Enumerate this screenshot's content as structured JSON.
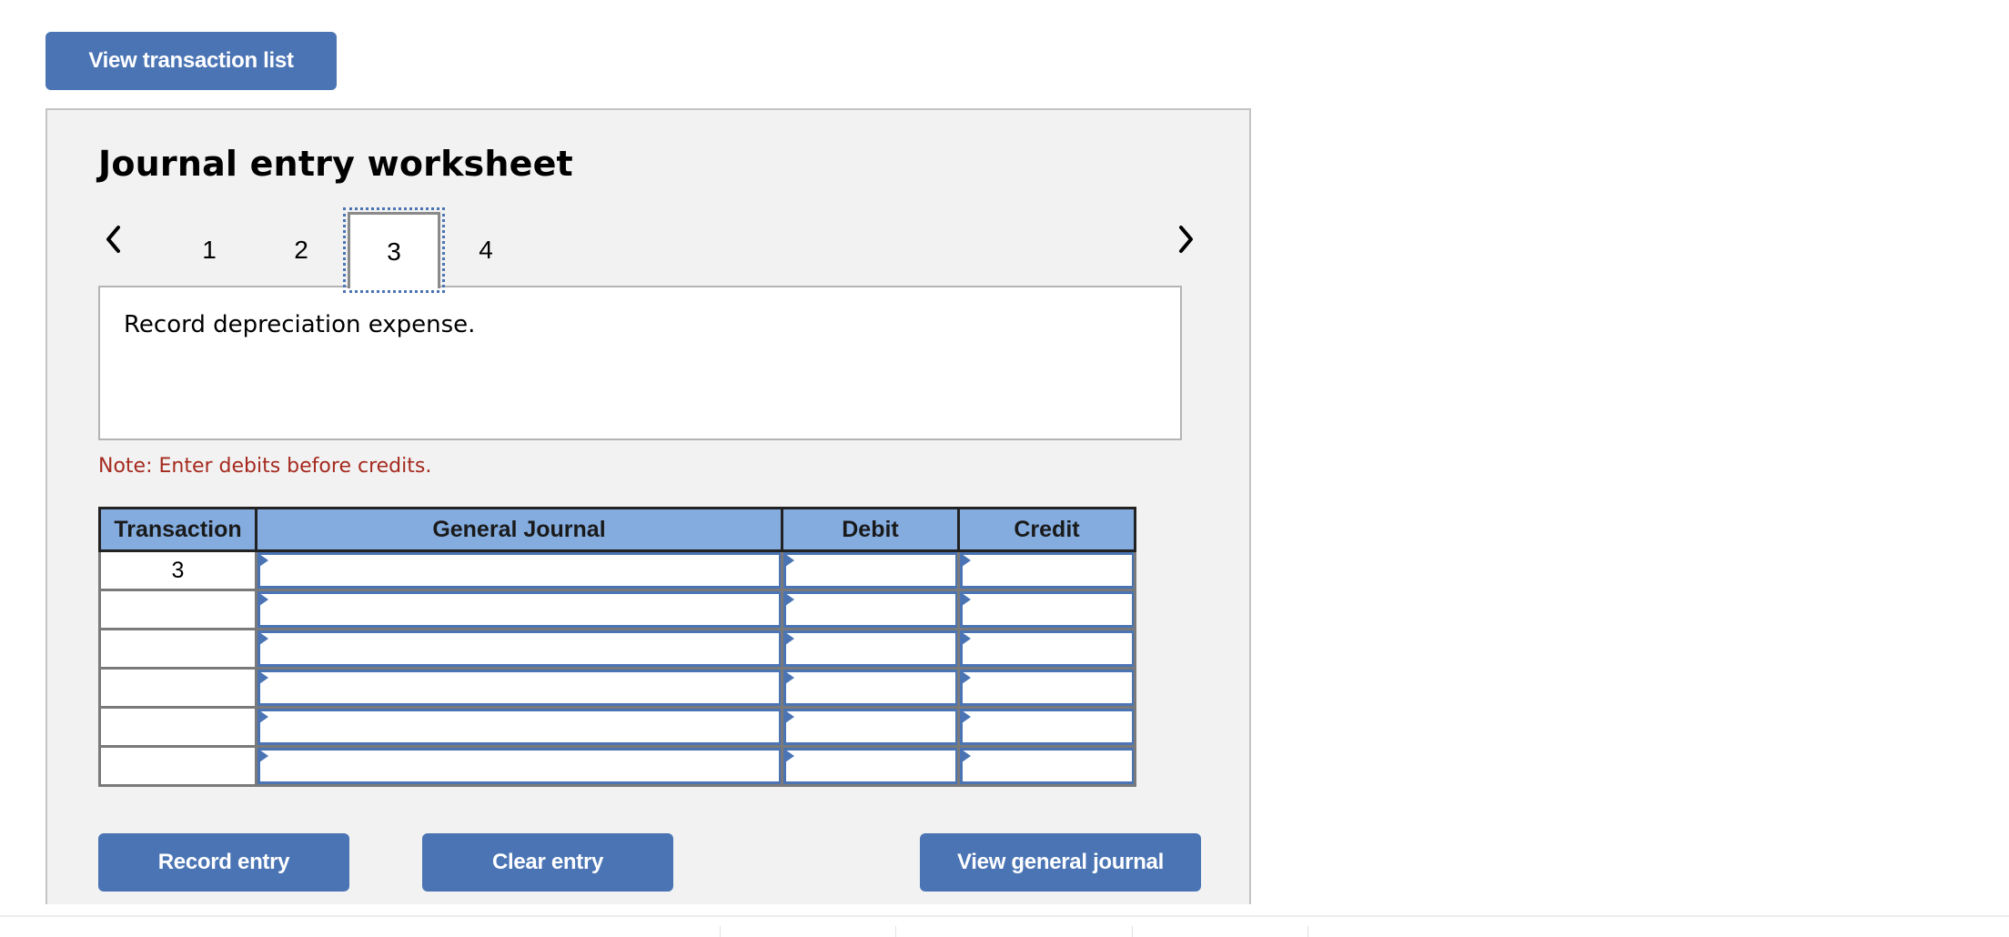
{
  "toolbar": {
    "view_transaction_list_label": "View transaction list"
  },
  "worksheet": {
    "title": "Journal entry worksheet",
    "nav": {
      "prev_icon": "chevron-left-icon",
      "next_icon": "chevron-right-icon",
      "tabs": [
        {
          "label": "1",
          "active": false
        },
        {
          "label": "2",
          "active": false
        },
        {
          "label": "3",
          "active": true
        },
        {
          "label": "4",
          "active": false
        }
      ]
    },
    "question": "Record depreciation expense.",
    "note": "Note: Enter debits before credits.",
    "note_color": "#a52a1e",
    "table": {
      "columns": [
        "Transaction",
        "General Journal",
        "Debit",
        "Credit"
      ],
      "rows": [
        {
          "transaction": "3",
          "general_journal": "",
          "debit": "",
          "credit": ""
        },
        {
          "transaction": "",
          "general_journal": "",
          "debit": "",
          "credit": ""
        },
        {
          "transaction": "",
          "general_journal": "",
          "debit": "",
          "credit": ""
        },
        {
          "transaction": "",
          "general_journal": "",
          "debit": "",
          "credit": ""
        },
        {
          "transaction": "",
          "general_journal": "",
          "debit": "",
          "credit": ""
        },
        {
          "transaction": "",
          "general_journal": "",
          "debit": "",
          "credit": ""
        }
      ]
    },
    "buttons": {
      "record_entry": "Record entry",
      "clear_entry": "Clear entry",
      "view_general_journal": "View general journal"
    }
  },
  "colors": {
    "button_bg": "#4a74b4",
    "header_bg": "#84acdf",
    "panel_bg": "#f2f2f2",
    "input_border": "#4a74b4"
  }
}
